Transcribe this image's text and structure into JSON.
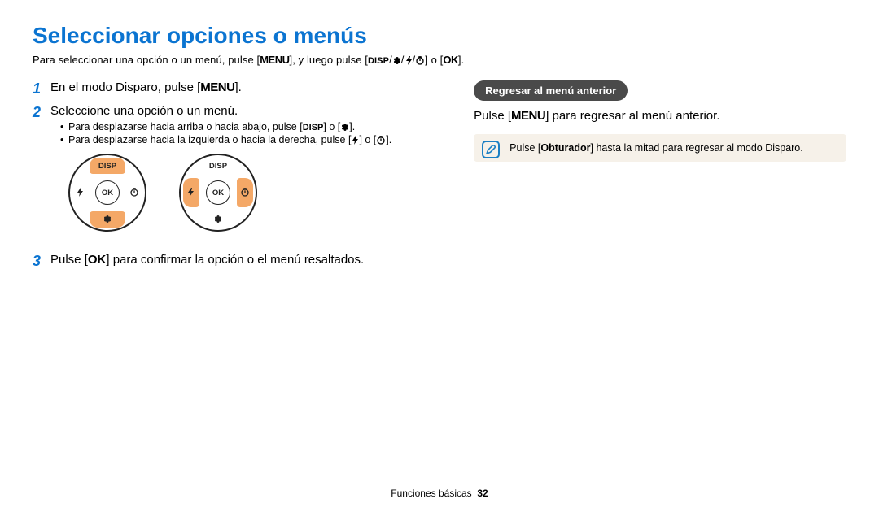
{
  "title": "Seleccionar opciones o menús",
  "intro": {
    "p1": "Para seleccionar una opción o un menú, pulse [",
    "menu": "MENU",
    "p2": "], y luego pulse [",
    "disp": "DISP",
    "p3": "] o [",
    "ok": "OK",
    "p4": "]."
  },
  "steps": {
    "n1": "1",
    "s1a": "En el modo Disparo, pulse [",
    "s1b": "].",
    "n2": "2",
    "s2": "Seleccione una opción o un menú.",
    "b1a": "Para desplazarse hacia arriba o hacia abajo, pulse [",
    "b1b": "] o [",
    "b1c": "].",
    "b2a": "Para desplazarse hacia la izquierda o hacia la derecha, pulse [",
    "b2b": "] o [",
    "b2c": "].",
    "n3": "3",
    "s3a": "Pulse [",
    "s3b": "] para confirmar la opción o el menú resaltados."
  },
  "dial": {
    "disp": "DISP",
    "ok": "OK"
  },
  "right": {
    "pill": "Regresar al menú anterior",
    "t1": "Pulse [",
    "t2": "] para regresar al menú anterior.",
    "note_a": "Pulse [",
    "note_bold": "Obturador",
    "note_b": "] hasta la mitad para regresar al modo Disparo."
  },
  "footer": {
    "section": "Funciones básicas",
    "page": "32"
  }
}
